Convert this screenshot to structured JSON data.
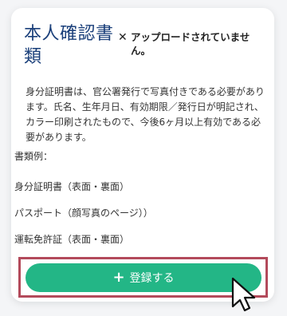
{
  "card": {
    "title": "本人確認書類",
    "status_icon": "close-icon",
    "status_text": "アップロードされていません。",
    "description": "身分証明書は、官公署発行で写真付きである必要があります。氏名、生年月日、有効期限／発行日が明記され、カラー印刷されたもので、今後6ヶ月以上有効である必要があります。",
    "doc_label": "書類例：",
    "doc_examples": [
      "身分証明書（表面・裏面）",
      "パスポート（顔写真のページ））",
      "運転免許証（表面・裏面）"
    ]
  },
  "button": {
    "icon": "plus-icon",
    "label": "登録する",
    "color": "#23b686"
  },
  "colors": {
    "title": "#1a3f7a",
    "highlight_border": "#b34a5b"
  }
}
